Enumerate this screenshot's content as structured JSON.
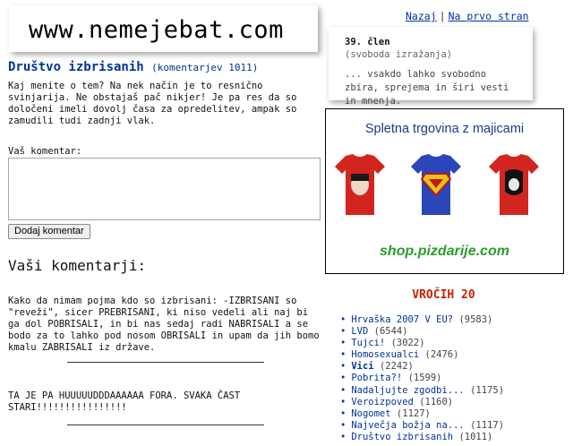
{
  "header": {
    "logo": "www.nemejebat.com",
    "nav_back": "Nazaj",
    "nav_sep": "|",
    "nav_home": "Na prvo stran"
  },
  "article": {
    "number": "39. člen",
    "subtitle": "(svoboda izražanja)",
    "text": "... vsakdo lahko svobodno zbira, sprejema in širi vesti in mnenja."
  },
  "post": {
    "title": "Društvo izbrisanih",
    "count": "(komentarjev 1011)",
    "intro": "Kaj menite o tem? Na nek način je to resnično svinjarija. Ne obstajaš pač nikjer! Je pa res da so določeni imeli dovolj časa za opredelitev, ampak so zamudili tudi zadnji vlak."
  },
  "form": {
    "label": "Vaš komentar:",
    "value": "",
    "button": "Dodaj komentar"
  },
  "comments": {
    "heading": "Vaši komentarji:",
    "items": [
      "Kako da nimam pojma kdo so izbrisani: -IZBRISANI so \"reveži\", sicer PREBRISANI, ki niso vedeli ali naj bi ga dol POBRISALI, in bi nas sedaj radi NABRISALI a se bodo za to lahko pod nosom OBRISALI in upam da jih bomo kmalu ZABRISALI iz države.",
      "TA JE PA HUUUUUDDDAAAAAA FORA. SVAKA ČAST STARI!!!!!!!!!!!!!!!!"
    ]
  },
  "ad": {
    "title": "Spletna trgovina z majicami",
    "shop": "shop.pizdarije.com"
  },
  "hot": {
    "title": "VROČIH 20",
    "items": [
      {
        "name": "Hrvaška 2007 V EU?",
        "count": "(9583)"
      },
      {
        "name": "LVD",
        "count": "(6544)"
      },
      {
        "name": "Tujci!",
        "count": "(3022)"
      },
      {
        "name": "Homosexualci",
        "count": "(2476)"
      },
      {
        "name": "Vici",
        "count": "(2242)"
      },
      {
        "name": "Pobrita?!",
        "count": "(1599)"
      },
      {
        "name": "Nadaljujte zgodbi...",
        "count": "(1175)"
      },
      {
        "name": "Veroizpoved",
        "count": "(1160)"
      },
      {
        "name": "Nogomet",
        "count": "(1127)"
      },
      {
        "name": "Največja božja na...",
        "count": "(1117)"
      },
      {
        "name": "Društvo izbrisanih",
        "count": "(1011)"
      }
    ]
  },
  "colors": {
    "link": "#003399",
    "hot_title": "#cc2200",
    "shop": "#2a9d2a",
    "ad_title": "#1a3a8a"
  }
}
